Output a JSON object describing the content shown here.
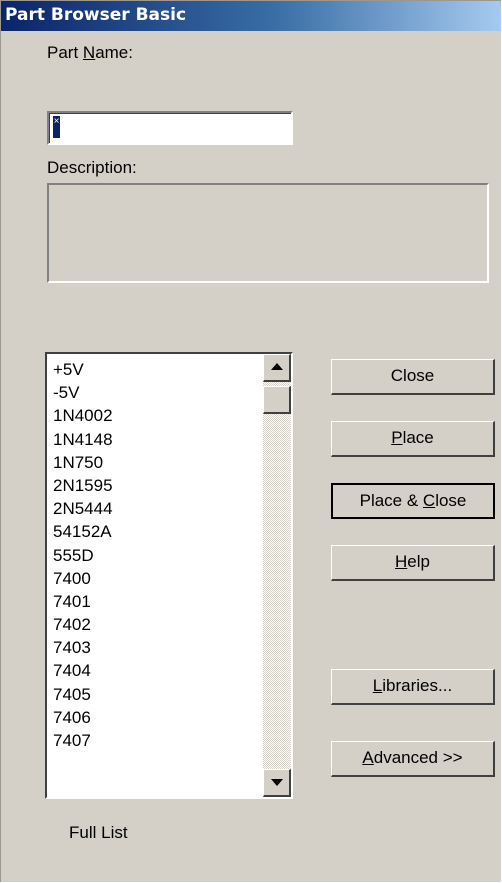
{
  "window": {
    "title": "Part Browser Basic"
  },
  "part_name": {
    "label_pre": "Part ",
    "label_key": "N",
    "label_post": "ame:",
    "value": ""
  },
  "description": {
    "label": "Description:",
    "value": ""
  },
  "parts_list": {
    "items": [
      "+5V",
      "-5V",
      "1N4002",
      "1N4148",
      "1N750",
      "2N1595",
      "2N5444",
      "54152A",
      "555D",
      "7400",
      "7401",
      "7402",
      "7403",
      "7404",
      "7405",
      "7406",
      "7407"
    ]
  },
  "buttons": {
    "close": {
      "label": "Close"
    },
    "place": {
      "key": "P",
      "rest": "lace"
    },
    "place_close": {
      "pre": "Place & ",
      "key": "C",
      "rest": "lose"
    },
    "help": {
      "key": "H",
      "rest": "elp"
    },
    "libraries": {
      "key": "L",
      "rest": "ibraries..."
    },
    "advanced": {
      "key": "A",
      "rest": "dvanced >>"
    }
  },
  "footer": {
    "status": "Full List"
  },
  "colors": {
    "face": "#d4d0c8",
    "title_start": "#0a246a",
    "title_end": "#a6caf0"
  }
}
